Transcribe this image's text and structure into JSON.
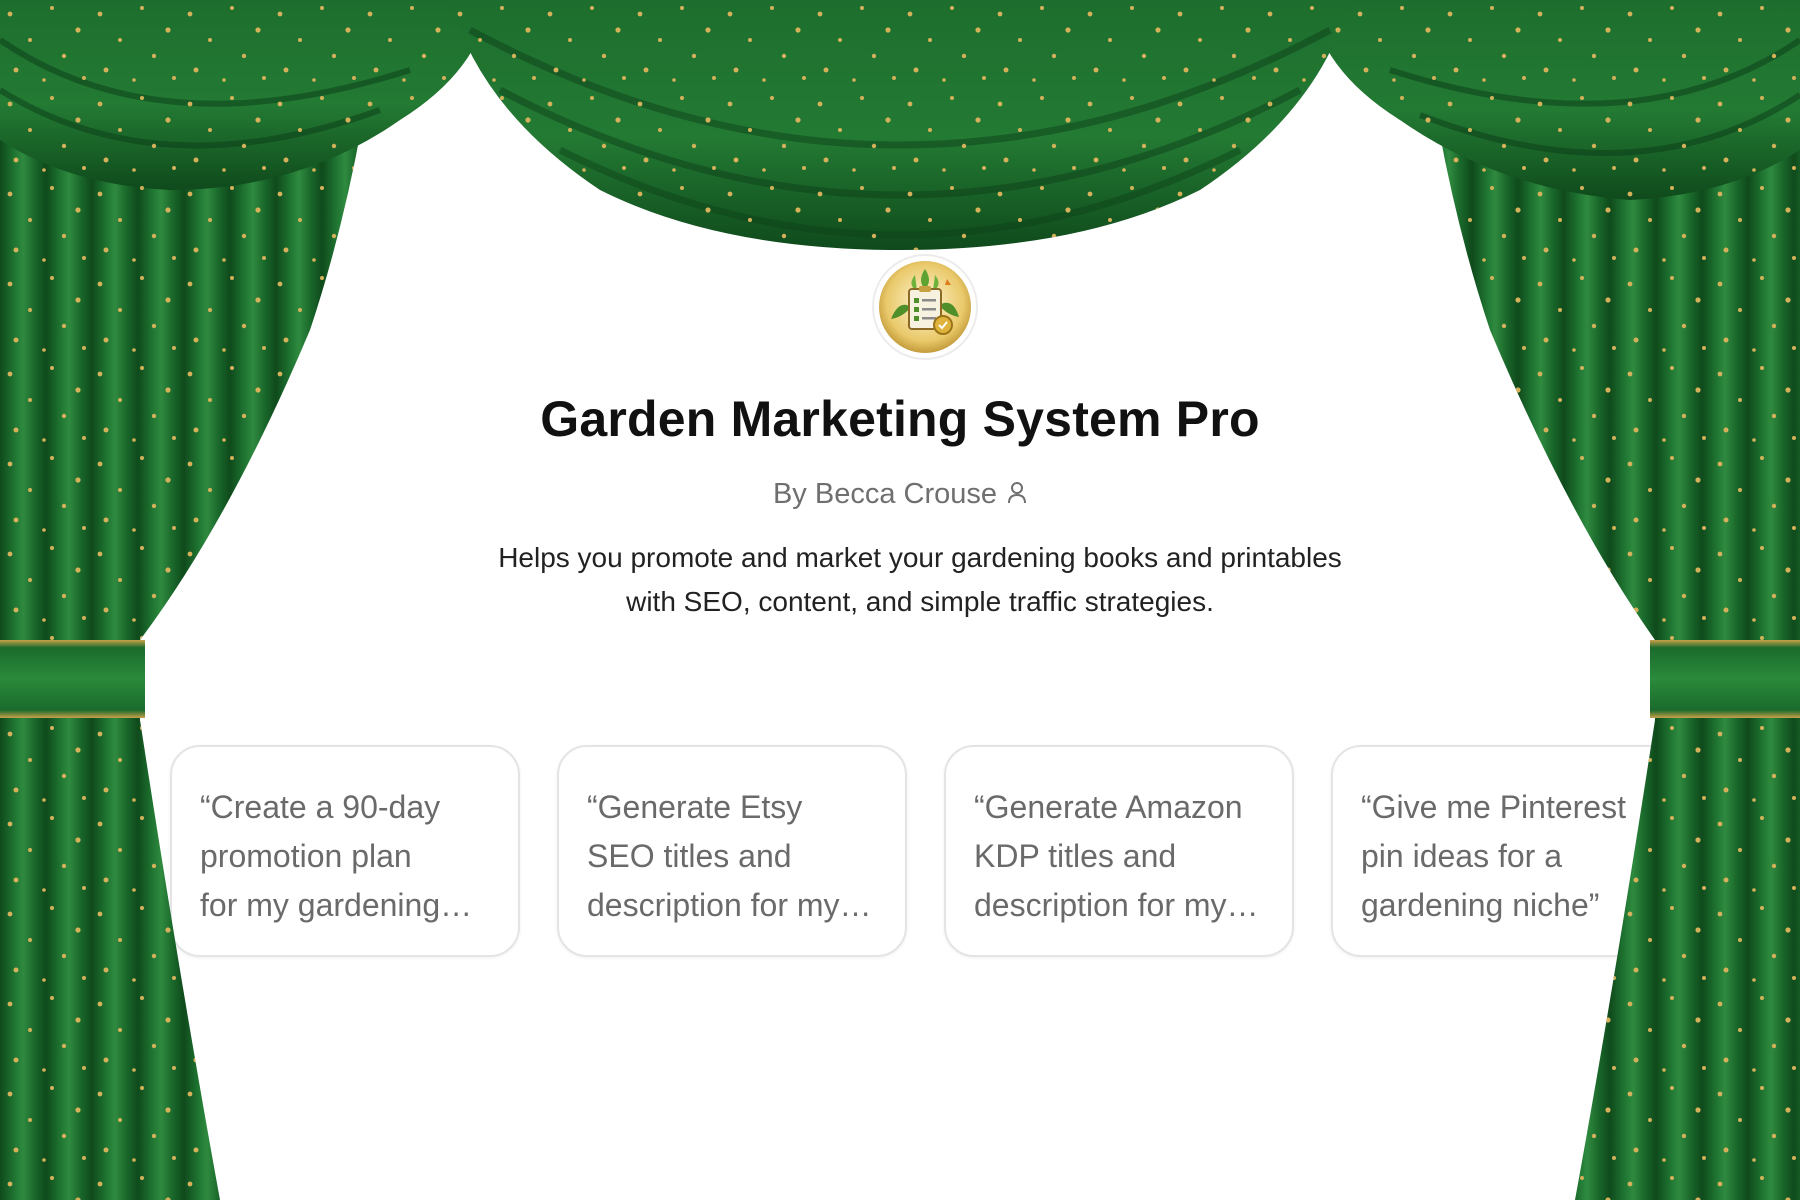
{
  "gpt": {
    "title": "Garden Marketing System Pro",
    "byline": "By Becca Crouse",
    "author_icon": "person-icon",
    "avatar_icon": "garden-clipboard-icon",
    "description_lines": [
      "Helps you promote and market your gardening books and printables",
      "with SEO, content, and simple traffic strategies."
    ]
  },
  "conversation_starters": [
    {
      "text": "“Create a 90-day\npromotion plan\nfor my gardening…"
    },
    {
      "text": "“Generate Etsy\nSEO titles and\ndescription for my…"
    },
    {
      "text": "“Generate Amazon\nKDP titles and\ndescription for my…"
    },
    {
      "text": "“Give me Pinterest\npin ideas for a\ngardening niche”"
    }
  ],
  "theme": {
    "curtain_green": "#1b6b2c",
    "curtain_dark": "#0f4a1c",
    "curtain_light": "#2f8a3f",
    "sparkle_gold": "#d4b15a",
    "tieback_gold": "#c9a04a"
  }
}
